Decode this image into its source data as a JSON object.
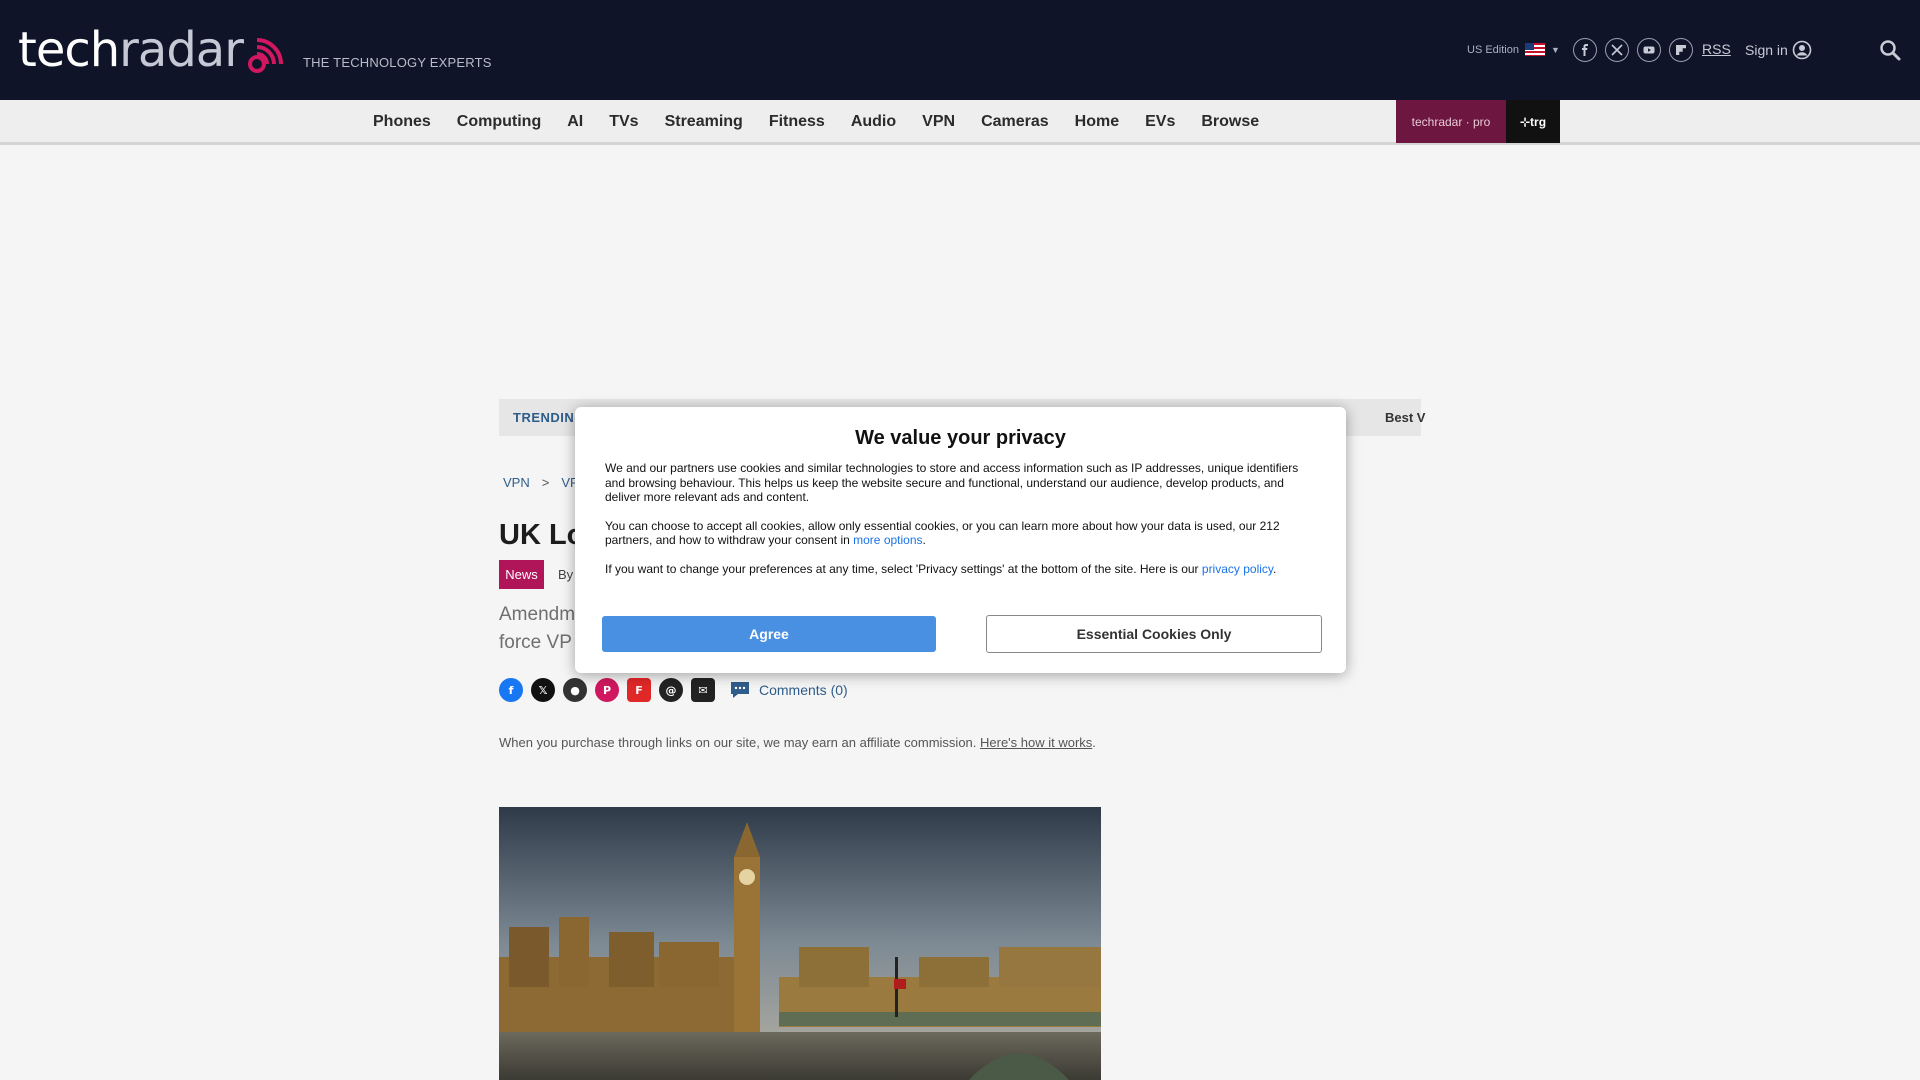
{
  "header": {
    "logo_text_a": "tech",
    "logo_text_b": "radar",
    "tagline": "THE TECHNOLOGY EXPERTS",
    "edition": "US Edition",
    "rss_label": "RSS",
    "signin_label": "Sign in",
    "social_icons": [
      "facebook-icon",
      "x-icon",
      "youtube-icon",
      "flipboard-icon"
    ]
  },
  "nav": {
    "items": [
      "Phones",
      "Computing",
      "AI",
      "TVs",
      "Streaming",
      "Fitness",
      "Audio",
      "VPN",
      "Cameras",
      "Home",
      "EVs",
      "Browse"
    ],
    "pro_label": "techradar · pro",
    "trg_label": "⊹trg"
  },
  "trending": {
    "label": "TRENDIN",
    "right_text": "Best V"
  },
  "article": {
    "breadcrumb": [
      "VPN",
      "VP"
    ],
    "breadcrumb_sep": ">",
    "title": "UK Lo",
    "tag": "News",
    "byline": "By",
    "standfirst_line1": "Amendm",
    "standfirst_line2": "force VP",
    "comments_label": "Comments (0)",
    "affiliate_text": "When you purchase through links on our site, we may earn an affiliate commission. ",
    "affiliate_link": "Here's how it works",
    "affiliate_end": "."
  },
  "modal": {
    "title": "We value your privacy",
    "p1": "We and our partners use cookies and similar technologies to store and access information such as IP addresses, unique identifiers and browsing behaviour. This helps us keep the website secure and functional, understand our audience, develop products, and deliver more relevant ads and content.",
    "p2_a": "You can choose to accept all cookies, allow only essential cookies, or you can learn more about how your data is used, our 212 partners, and how to withdraw your consent in ",
    "p2_link": "more options",
    "p2_b": ".",
    "p3_a": "If you want to change your preferences at any time, select 'Privacy settings' at the bottom of the site. Here is our ",
    "p3_link": "privacy policy",
    "p3_b": ".",
    "agree_label": "Agree",
    "essential_label": "Essential Cookies Only"
  },
  "colors": {
    "header_bg": "#0f1428",
    "accent_magenta": "#b0155a",
    "agree_blue": "#4a90e2",
    "link_blue": "#2f5d8a"
  }
}
